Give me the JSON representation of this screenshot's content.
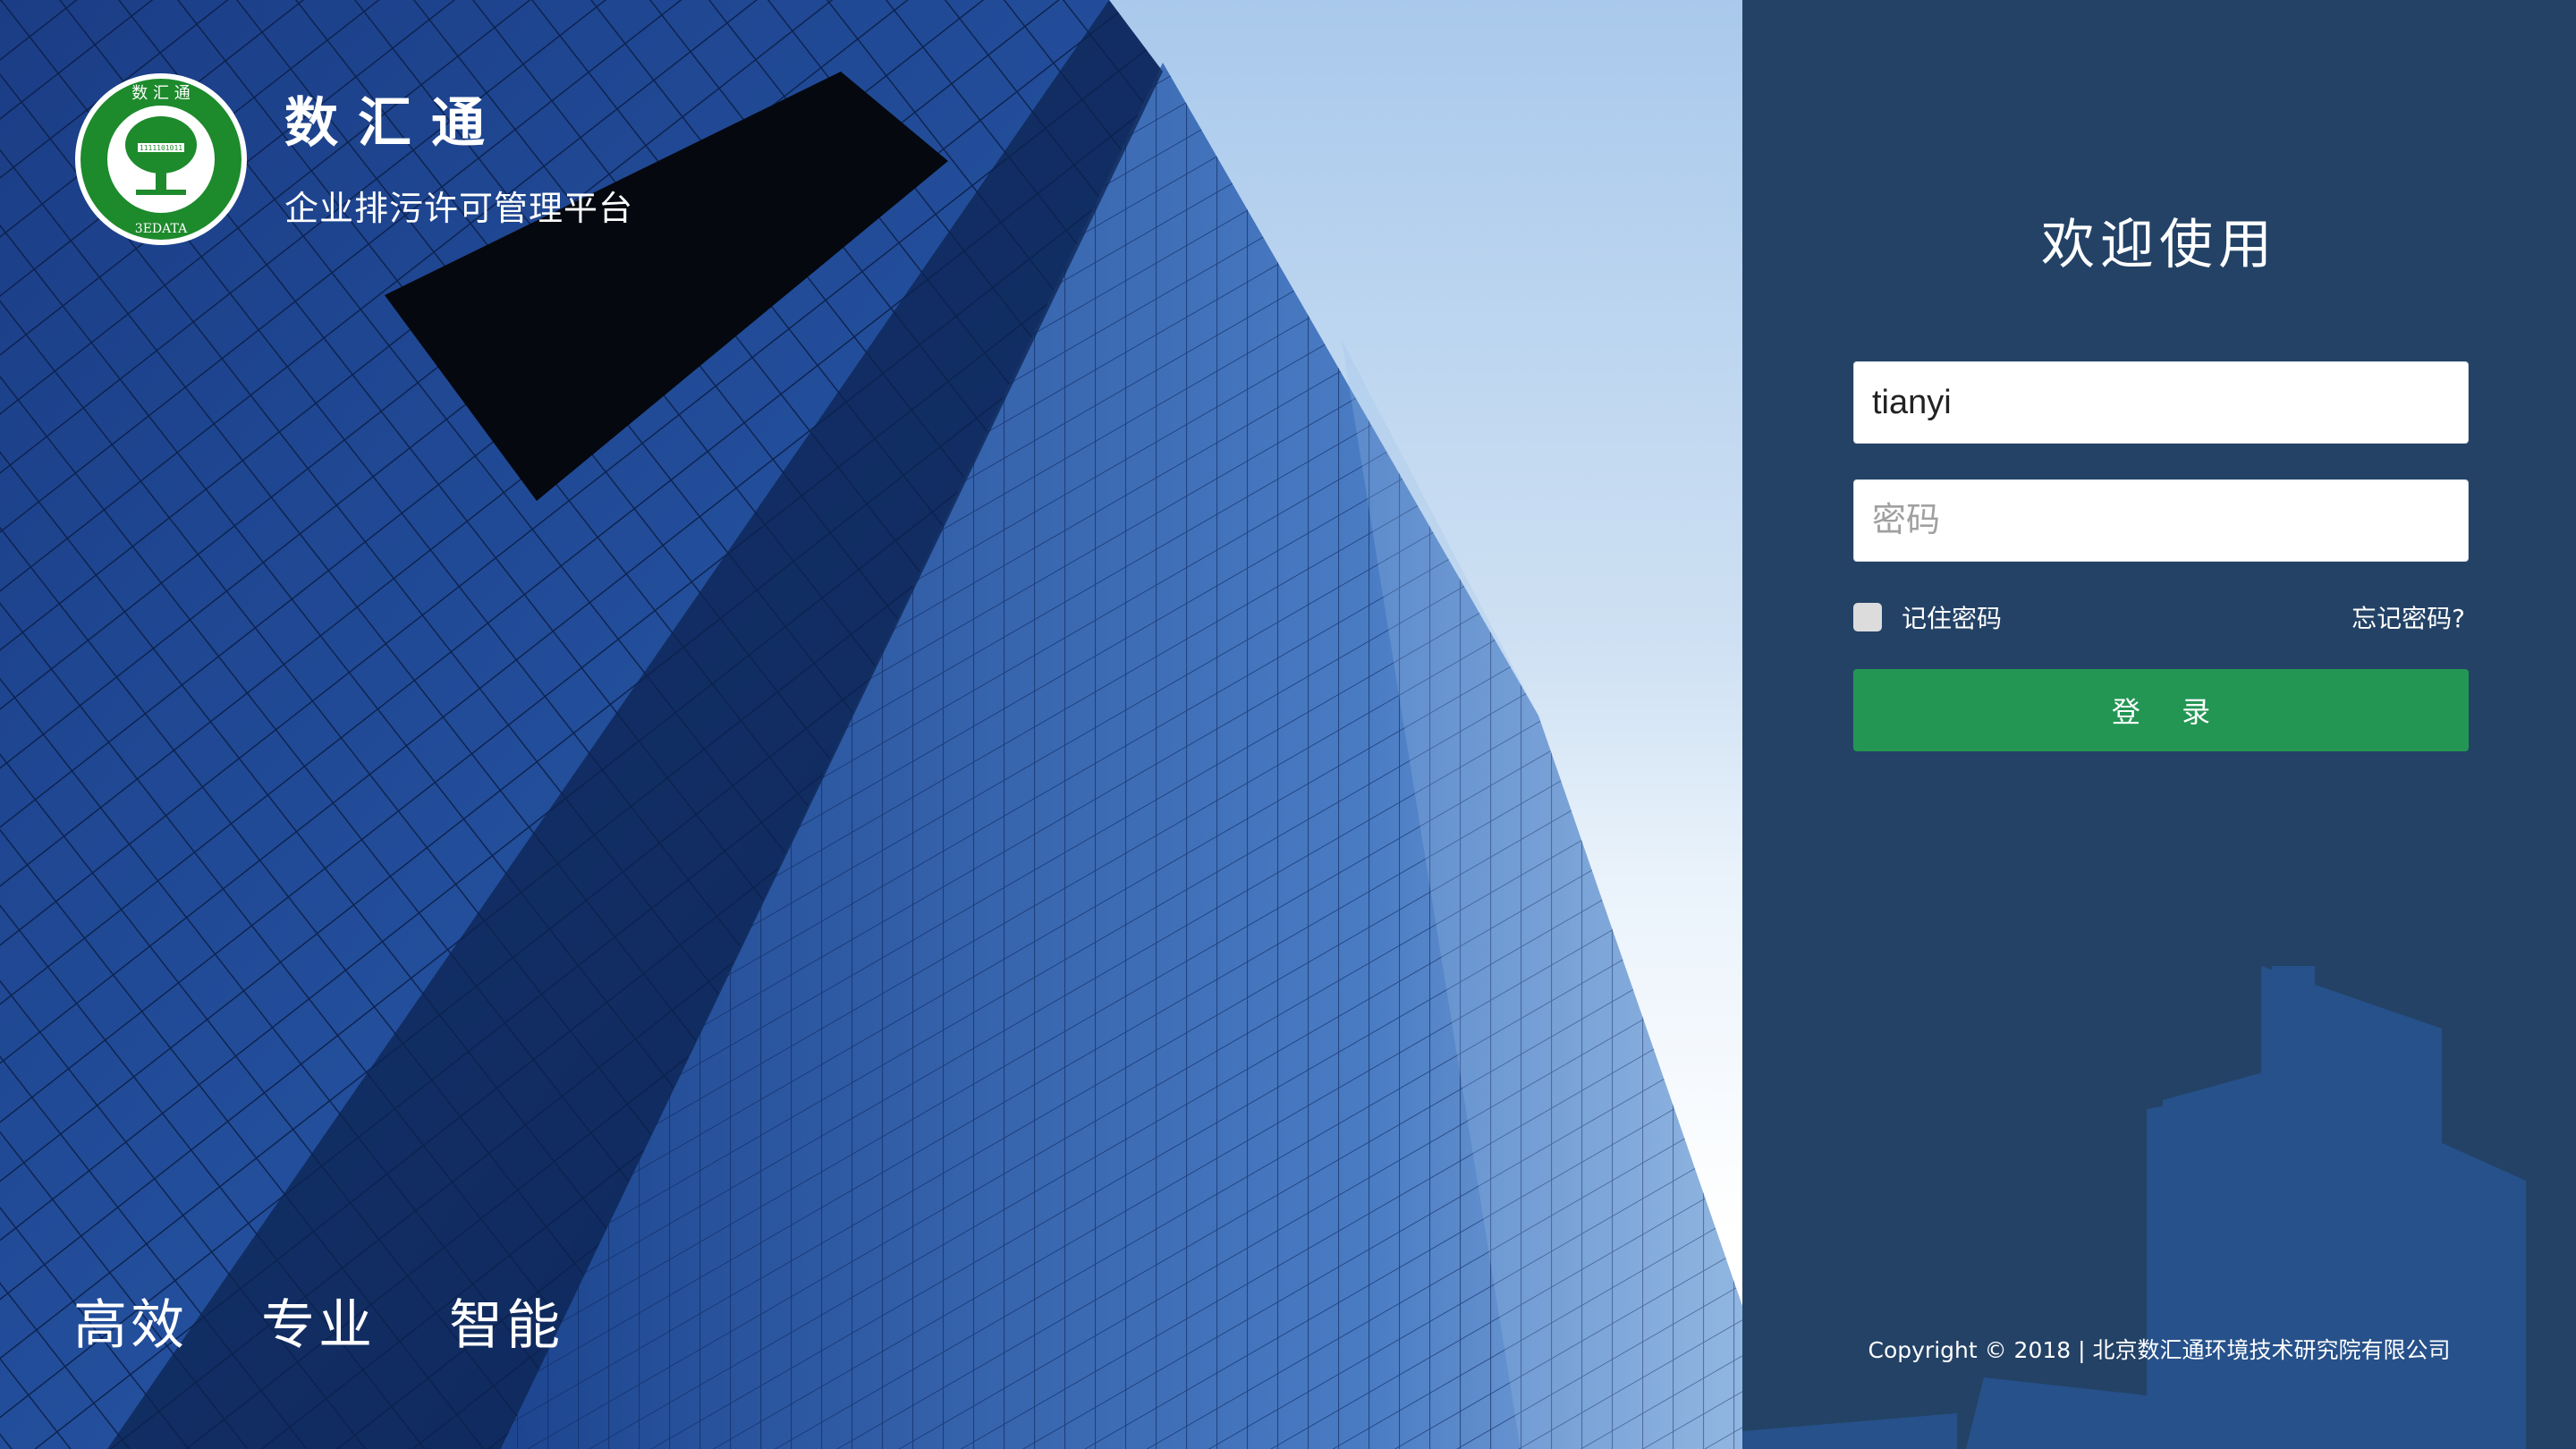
{
  "brand": {
    "logo_top_text": "数 汇 通",
    "logo_bottom_text": "3EDATA",
    "name": "数汇通",
    "subtitle": "企业排污许可管理平台"
  },
  "slogans": [
    "高效",
    "专业",
    "智能"
  ],
  "login": {
    "welcome": "欢迎使用",
    "username_value": "tianyi",
    "password_placeholder": "密码",
    "remember_label": "记住密码",
    "forgot_label": "忘记密码?",
    "submit_label": "登 录"
  },
  "footer": {
    "copyright": "Copyright © 2018 | 北京数汇通环境技术研究院有限公司"
  },
  "colors": {
    "panel_bg": "#234266",
    "login_button": "#239654",
    "logo_green": "#1d8a2c"
  },
  "icons": {
    "logo": "tree-emblem"
  }
}
